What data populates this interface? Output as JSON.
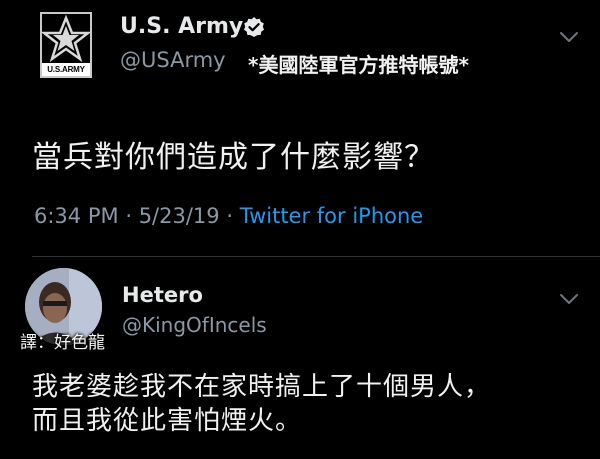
{
  "tweet1": {
    "logo_text": "U.S.ARMY",
    "display_name": "U.S. Army",
    "handle": "@USArmy",
    "annotation": "*美國陸軍官方推特帳號*",
    "body": "當兵對你們造成了什麼影響？",
    "time": "6:34 PM",
    "date": "5/23/19",
    "separator": "·",
    "source": "Twitter for iPhone"
  },
  "tweet2": {
    "display_name": "Hetero",
    "handle": "@KingOfIncels",
    "translator_note": "譯：好色龍",
    "body_lines": [
      "我老婆趁我不在家時搞上了十個男人，",
      "而且我從此害怕煙火。"
    ]
  },
  "colors": {
    "background": "#000000",
    "primary_text": "#e7e9ea",
    "secondary_text": "#8b98a5",
    "link": "#1d9bf0",
    "verified": "#e7e9ea",
    "divider": "#2f3336"
  },
  "icons": {
    "verified": "verified-badge-icon",
    "menu": "chevron-down-icon"
  }
}
